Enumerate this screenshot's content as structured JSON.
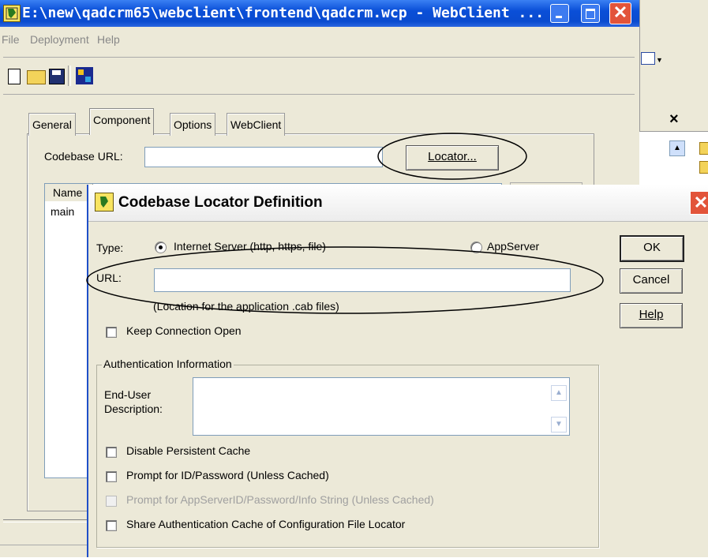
{
  "main_window": {
    "title": "E:\\new\\qadcrm65\\webclient\\frontend\\qadcrm.wcp - WebClient ...",
    "menu": [
      "File",
      "Deployment",
      "Help"
    ],
    "tabs": [
      "General",
      "Component",
      "Options",
      "WebClient"
    ],
    "codebase_label": "Codebase URL:",
    "locator_button": "Locator...",
    "list_header": "Name",
    "list_items": [
      "main"
    ],
    "side_close": "×"
  },
  "dialog": {
    "title": "Codebase Locator Definition",
    "type_label": "Type:",
    "type_option_internet": "Internet Server (http, https, file)",
    "type_option_appserver": "AppServer",
    "url_label": "URL:",
    "url_value": "",
    "url_hint": "(Location for the application .cab files)",
    "keep_connection": "Keep Connection Open",
    "auth_group": "Authentication Information",
    "end_user_label_1": "End-User",
    "end_user_label_2": "Description:",
    "end_user_value": "",
    "chk_disable_cache": "Disable Persistent Cache",
    "chk_prompt_id": "Prompt for ID/Password (Unless Cached)",
    "chk_prompt_appserver": "Prompt for AppServerID/Password/Info String (Unless Cached)",
    "chk_share_cache": "Share Authentication Cache of Configuration File Locator",
    "btn_ok": "OK",
    "btn_cancel": "Cancel",
    "btn_help": "Help"
  }
}
